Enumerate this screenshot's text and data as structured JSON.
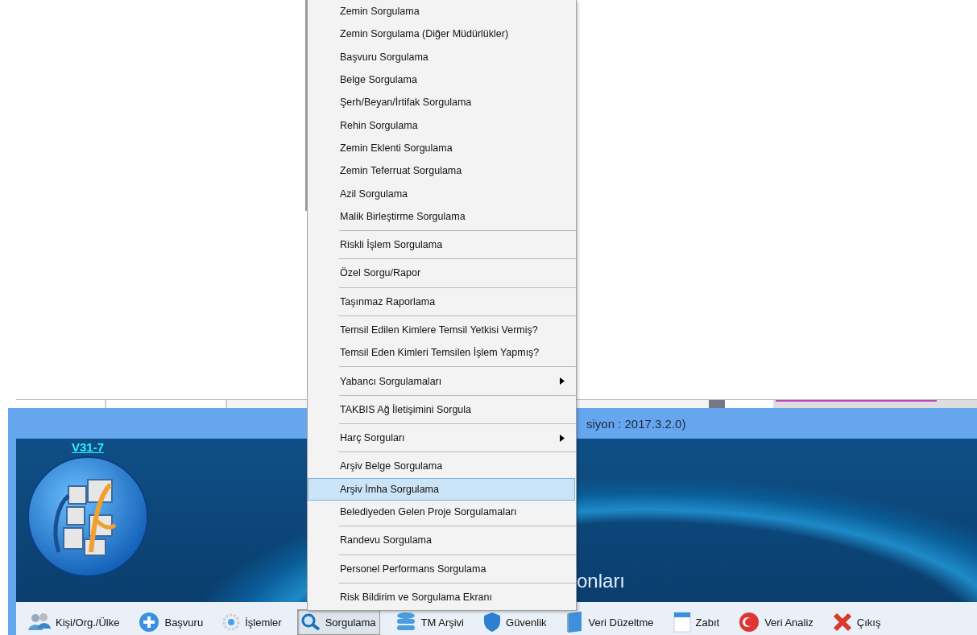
{
  "window": {
    "title_visible": "siyon : 2017.3.2.0)",
    "version_link": "V31-7",
    "banner_text": "onları"
  },
  "toolbar": [
    {
      "label": "Kişi/Org./Ülke",
      "selected": false
    },
    {
      "label": "Başvuru",
      "selected": false
    },
    {
      "label": "İşlemler",
      "selected": false
    },
    {
      "label": "Sorgulama",
      "selected": true
    },
    {
      "label": "TM Arşivi",
      "selected": false
    },
    {
      "label": "Güvenlik",
      "selected": false
    },
    {
      "label": "Veri Düzeltme",
      "selected": false
    },
    {
      "label": "Zabıt",
      "selected": false
    },
    {
      "label": "Veri Analiz",
      "selected": false
    },
    {
      "label": "Çıkış",
      "selected": false
    }
  ],
  "menu": {
    "groups": [
      [
        {
          "label": "Zemin Sorgulama",
          "submenu": false,
          "selected": false
        },
        {
          "label": "Zemin Sorgulama (Diğer Müdürlükler)",
          "submenu": false,
          "selected": false
        },
        {
          "label": "Başvuru Sorgulama",
          "submenu": false,
          "selected": false
        },
        {
          "label": "Belge Sorgulama",
          "submenu": false,
          "selected": false
        },
        {
          "label": "Şerh/Beyan/İrtifak Sorgulama",
          "submenu": false,
          "selected": false
        },
        {
          "label": "Rehin Sorgulama",
          "submenu": false,
          "selected": false
        },
        {
          "label": "Zemin Eklenti Sorgulama",
          "submenu": false,
          "selected": false
        },
        {
          "label": "Zemin Teferruat Sorgulama",
          "submenu": false,
          "selected": false
        },
        {
          "label": "Azil Sorgulama",
          "submenu": false,
          "selected": false
        },
        {
          "label": "Malik Birleştirme Sorgulama",
          "submenu": false,
          "selected": false
        }
      ],
      [
        {
          "label": "Riskli İşlem Sorgulama",
          "submenu": false,
          "selected": false
        }
      ],
      [
        {
          "label": "Özel Sorgu/Rapor",
          "submenu": false,
          "selected": false
        }
      ],
      [
        {
          "label": "Taşınmaz Raporlama",
          "submenu": false,
          "selected": false
        }
      ],
      [
        {
          "label": "Temsil Edilen Kimlere Temsil Yetkisi Vermiş?",
          "submenu": false,
          "selected": false
        },
        {
          "label": "Temsil Eden Kimleri Temsilen İşlem Yapmış?",
          "submenu": false,
          "selected": false
        }
      ],
      [
        {
          "label": "Yabancı Sorgulamaları",
          "submenu": true,
          "selected": false
        }
      ],
      [
        {
          "label": "TAKBIS Ağ İletişimini Sorgula",
          "submenu": false,
          "selected": false
        }
      ],
      [
        {
          "label": "Harç Sorguları",
          "submenu": true,
          "selected": false
        }
      ],
      [
        {
          "label": "Arşiv Belge Sorgulama",
          "submenu": false,
          "selected": false
        },
        {
          "label": "Arşiv İmha Sorgulama",
          "submenu": false,
          "selected": true
        },
        {
          "label": "Belediyeden Gelen Proje Sorgulamaları",
          "submenu": false,
          "selected": false
        }
      ],
      [
        {
          "label": "Randevu Sorgulama",
          "submenu": false,
          "selected": false
        }
      ],
      [
        {
          "label": "Personel Performans Sorgulama",
          "submenu": false,
          "selected": false
        }
      ],
      [
        {
          "label": "Risk Bildirim ve Sorgulama Ekranı",
          "submenu": false,
          "selected": false
        }
      ]
    ]
  }
}
